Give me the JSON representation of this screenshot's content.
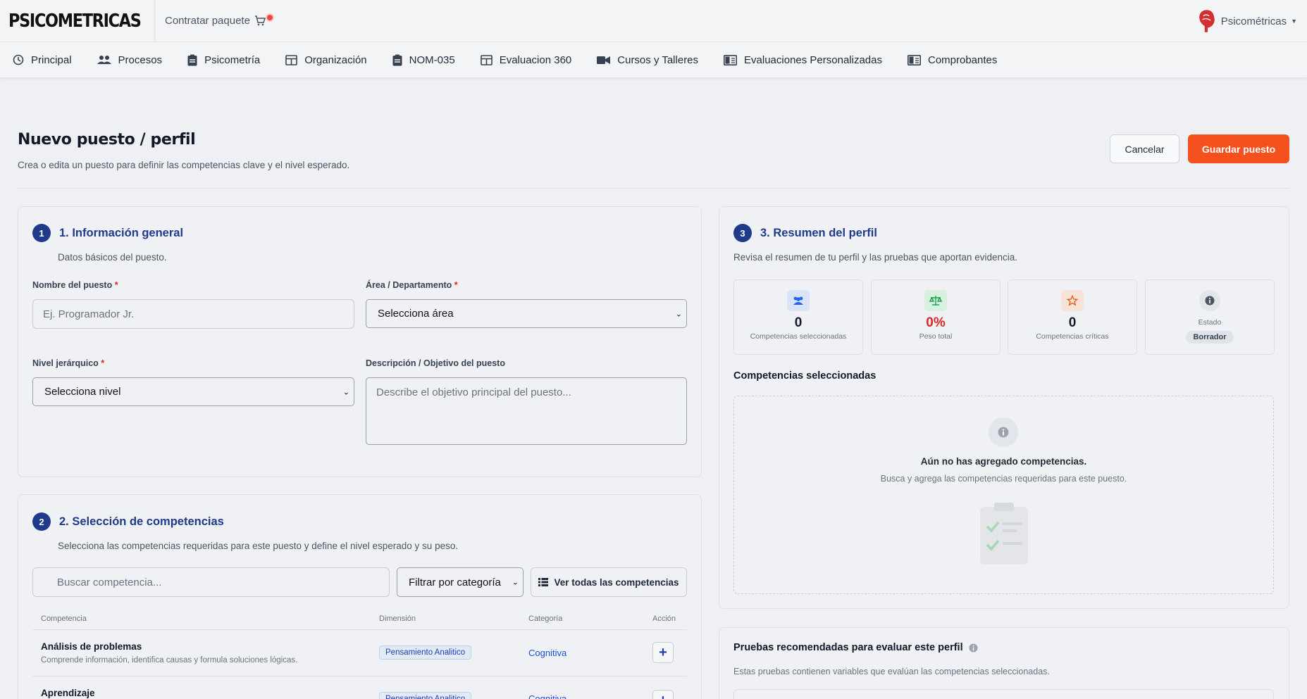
{
  "header": {
    "brand": "PSICOMETRICAS",
    "contratar": "Contratar paquete",
    "user_name": "Psicométricas"
  },
  "nav": [
    {
      "label": "Principal",
      "icon": "clock-icon"
    },
    {
      "label": "Procesos",
      "icon": "people-icon"
    },
    {
      "label": "Psicometría",
      "icon": "clipboard-icon"
    },
    {
      "label": "Organización",
      "icon": "table-icon"
    },
    {
      "label": "NOM-035",
      "icon": "clipboard-icon"
    },
    {
      "label": "Evaluacion 360",
      "icon": "table-icon"
    },
    {
      "label": "Cursos y Talleres",
      "icon": "video-icon"
    },
    {
      "label": "Evaluaciones Personalizadas",
      "icon": "book-icon"
    },
    {
      "label": "Comprobantes",
      "icon": "book-icon"
    }
  ],
  "page": {
    "title": "Nuevo puesto / perfil",
    "subtitle": "Crea o edita un puesto para definir las competencias clave y el nivel esperado.",
    "cancel_label": "Cancelar",
    "save_label": "Guardar puesto"
  },
  "section1": {
    "number": "1",
    "title": "1. Información general",
    "subtitle": "Datos básicos del puesto.",
    "nombre_label": "Nombre del puesto",
    "nombre_placeholder": "Ej. Programador Jr.",
    "area_label": "Área / Departamento",
    "area_value": "Selecciona área",
    "nivel_label": "Nivel jerárquico",
    "nivel_value": "Selecciona nivel",
    "desc_label": "Descripción / Objetivo del puesto",
    "desc_placeholder": "Describe el objetivo principal del puesto...",
    "required_mark": "*"
  },
  "section2": {
    "number": "2",
    "title": "2. Selección de competencias",
    "subtitle": "Selecciona las competencias requeridas para este puesto y define el nivel esperado y su peso.",
    "search_placeholder": "Buscar competencia...",
    "filter_value": "Filtrar por categoría",
    "ver_todas_label": "Ver todas las competencias",
    "columns": [
      "Competencia",
      "Dimensión",
      "Categoría",
      "Acción"
    ],
    "rows": [
      {
        "name": "Análisis de problemas",
        "desc": "Comprende información, identifica causas y formula soluciones lógicas.",
        "dimension": "Pensamiento Analitico",
        "category": "Cognitiva"
      },
      {
        "name": "Aprendizaje",
        "desc": "",
        "dimension": "Pensamiento Analitico",
        "category": "Cognitiva"
      }
    ],
    "add_label": "+"
  },
  "section3": {
    "number": "3",
    "title": "3. Resumen del perfil",
    "subtitle": "Revisa el resumen de tu perfil y las pruebas que aportan evidencia.",
    "stats": [
      {
        "value": "0",
        "label": "Competencias seleccionadas",
        "icon": "users-icon",
        "color": "#2563eb"
      },
      {
        "value": "0%",
        "label": "Peso total",
        "icon": "scale-icon",
        "color": "#16a34a"
      },
      {
        "value": "0",
        "label": "Competencias críticas",
        "icon": "star-icon",
        "color": "#ea580c"
      }
    ],
    "estado_label": "Estado",
    "estado_value": "Borrador",
    "selected_title": "Competencias seleccionadas",
    "empty_title": "Aún no has agregado competencias.",
    "empty_sub": "Busca y agrega las competencias requeridas para este puesto."
  },
  "pruebas": {
    "title": "Pruebas recomendadas para evaluar este perfil",
    "subtitle": "Estas pruebas contienen variables que evalúan las competencias seleccionadas."
  },
  "colors": {
    "accent": "#f4511e",
    "primary": "#1e3a8a",
    "danger": "#dc2626"
  }
}
